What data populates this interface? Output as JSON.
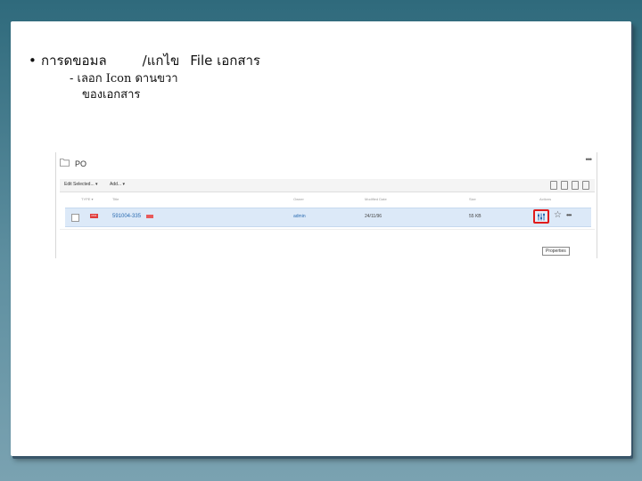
{
  "slide": {
    "bullet": "•",
    "title_part1": "การดขอมล",
    "title_part2": "/แกไข",
    "title_part3": "File เอกสาร",
    "sub_line1": "- เลอก  Icon ดานขวา",
    "sub_line2": "ของเอกสาร"
  },
  "screenshot": {
    "folder_name": "PO",
    "more_label": "•••",
    "toolbar": {
      "edit_selected": "Edit Selected... ▾",
      "add": "Add... ▾"
    },
    "columns": [
      "TYPE ▾",
      "Title",
      "Owner",
      "Modified Date",
      "Size",
      "Actions"
    ],
    "rows": [
      {
        "type": "PDF",
        "title": "591004-335",
        "owner": "admin",
        "modified": "24/11/96",
        "size": "55 KB",
        "more": "•••"
      }
    ],
    "tooltip": "Properties",
    "highlight_color": "#e01b1b"
  }
}
